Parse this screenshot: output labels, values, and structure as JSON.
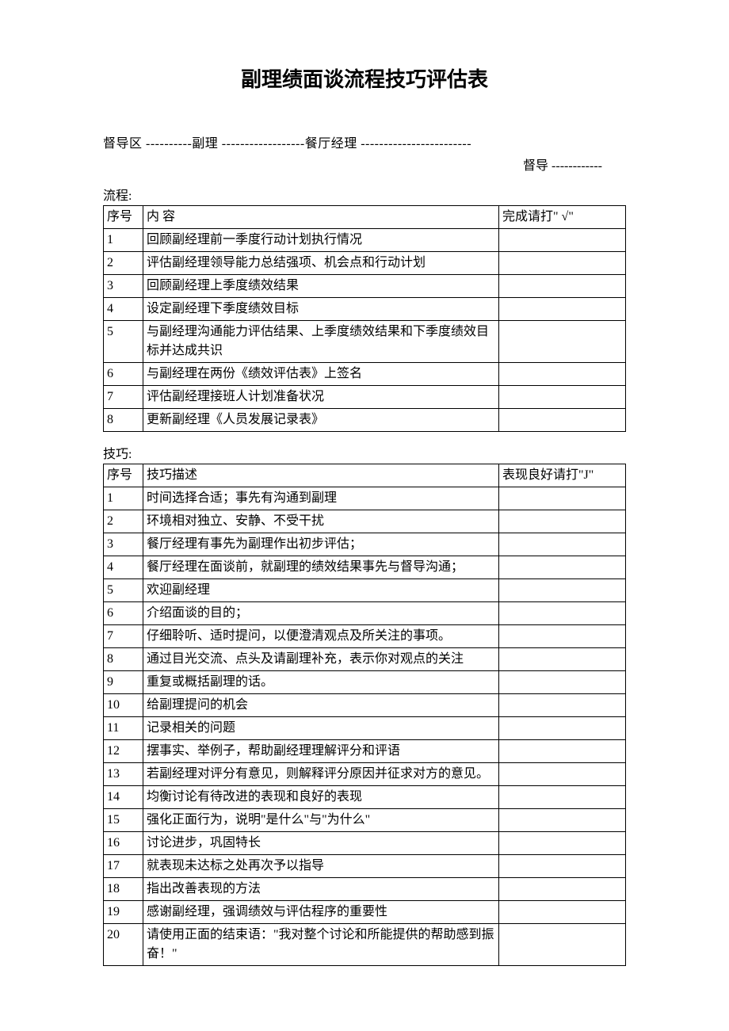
{
  "title": "副理绩面谈流程技巧评估表",
  "header": {
    "line1": "督导区 ----------副理 ------------------餐厅经理 ------------------------",
    "line2": "督导 ------------"
  },
  "section1": {
    "label": "流程:",
    "headers": {
      "seq": "序号",
      "content": "内                       容",
      "check": "完成请打\" √\""
    },
    "rows": [
      {
        "seq": "1",
        "content": "回顾副经理前一季度行动计划执行情况"
      },
      {
        "seq": "2",
        "content": "评估副经理领导能力总结强项、机会点和行动计划"
      },
      {
        "seq": "3",
        "content": "回顾副经理上季度绩效结果"
      },
      {
        "seq": "4",
        "content": "设定副经理下季度绩效目标"
      },
      {
        "seq": "5",
        "content": "与副经理沟通能力评估结果、上季度绩效结果和下季度绩效目标并达成共识"
      },
      {
        "seq": "6",
        "content": "与副经理在两份《绩效评估表》上签名"
      },
      {
        "seq": "7",
        "content": "评估副经理接班人计划准备状况"
      },
      {
        "seq": "8",
        "content": "更新副经理《人员发展记录表》"
      }
    ]
  },
  "section2": {
    "label": "技巧:",
    "headers": {
      "seq": "序号",
      "content": "技巧描述",
      "check": "表现良好请打\"J\""
    },
    "rows": [
      {
        "seq": "1",
        "content": "时间选择合适；事先有沟通到副理"
      },
      {
        "seq": "2",
        "content": "环境相对独立、安静、不受干扰"
      },
      {
        "seq": "3",
        "content": "餐厅经理有事先为副理作出初步评估；"
      },
      {
        "seq": "4",
        "content": "餐厅经理在面谈前，就副理的绩效结果事先与督导沟通；"
      },
      {
        "seq": "5",
        "content": "欢迎副经理"
      },
      {
        "seq": "6",
        "content": "介绍面谈的目的；"
      },
      {
        "seq": "7",
        "content": "仔细聆听、适时提问，以便澄清观点及所关注的事项。"
      },
      {
        "seq": "8",
        "content": "通过目光交流、点头及请副理补充，表示你对观点的关注"
      },
      {
        "seq": "9",
        "content": "重复或概括副理的话。"
      },
      {
        "seq": "10",
        "content": "给副理提问的机会"
      },
      {
        "seq": "11",
        "content": "记录相关的问题"
      },
      {
        "seq": "12",
        "content": "摆事实、举例子，帮助副经理理解评分和评语"
      },
      {
        "seq": "13",
        "content": "若副经理对评分有意见，则解释评分原因并征求对方的意见。"
      },
      {
        "seq": "14",
        "content": "均衡讨论有待改进的表现和良好的表现"
      },
      {
        "seq": "15",
        "content": "强化正面行为，说明\"是什么\"与\"为什么\""
      },
      {
        "seq": "16",
        "content": "讨论进步，巩固特长"
      },
      {
        "seq": "17",
        "content": "就表现未达标之处再次予以指导"
      },
      {
        "seq": "18",
        "content": "指出改善表现的方法"
      },
      {
        "seq": "19",
        "content": "感谢副经理，强调绩效与评估程序的重要性"
      },
      {
        "seq": "20",
        "content": "请使用正面的结束语：\"我对整个讨论和所能提供的帮助感到振奋！\""
      }
    ]
  }
}
